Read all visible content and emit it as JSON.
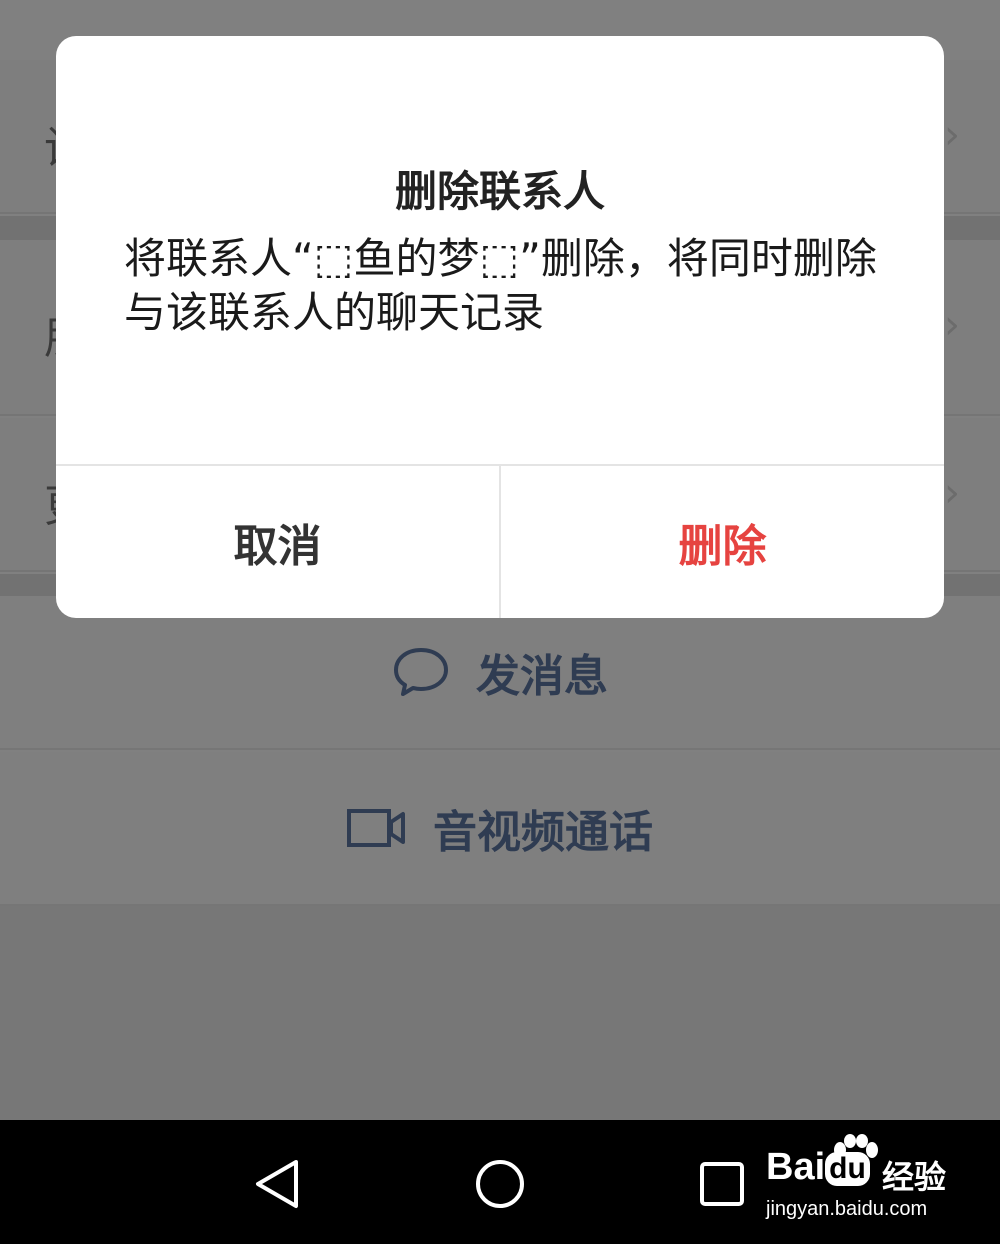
{
  "background": {
    "rows": [
      {
        "label_fragment": "设"
      },
      {
        "label_fragment": "朋"
      },
      {
        "label_fragment": "更"
      }
    ],
    "actions": [
      {
        "label": "发消息",
        "icon": "chat-bubble-icon"
      },
      {
        "label": "音视频通话",
        "icon": "video-camera-icon"
      }
    ]
  },
  "dialog": {
    "title": "删除联系人",
    "message": "将联系人“⬚鱼的梦⬚”删除，将同时删除与该联系人的聊天记录",
    "cancel_label": "取消",
    "delete_label": "删除",
    "delete_color": "#e64340"
  },
  "navbar": {
    "back_icon": "back-triangle-icon",
    "home_icon": "home-circle-icon",
    "recent_icon": "recent-square-icon"
  },
  "watermark": {
    "brand_prefix": "Bai",
    "brand_mid": "du",
    "brand_suffix": "经验",
    "url": "jingyan.baidu.com"
  }
}
